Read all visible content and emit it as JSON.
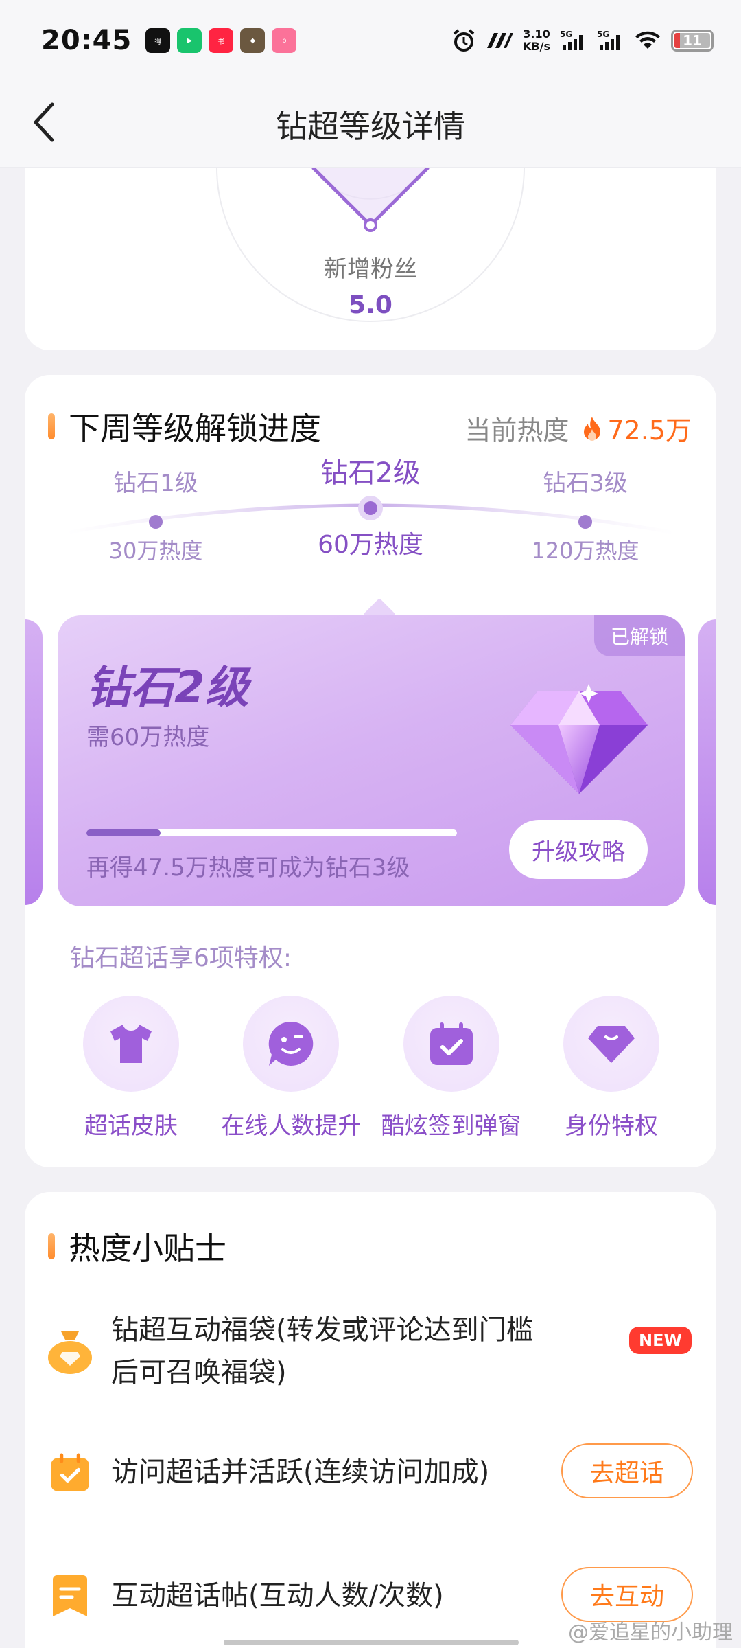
{
  "status_bar": {
    "time": "20:45",
    "apps": [
      "得物",
      "爱奇艺",
      "小红书",
      "游戏",
      "bilibili"
    ],
    "network_speed": "3.10\nKB/s",
    "signal1": "5G",
    "signal2": "5G",
    "battery": "11"
  },
  "header": {
    "title": "钻超等级详情"
  },
  "radar": {
    "label": "新增粉丝",
    "value": "5.0"
  },
  "progress": {
    "section_title": "下周等级解锁进度",
    "heat_label": "当前热度",
    "heat_value": "72.5万",
    "levels": [
      {
        "name": "钻石1级",
        "heat": "30万热度"
      },
      {
        "name": "钻石2级",
        "heat": "60万热度"
      },
      {
        "name": "钻石3级",
        "heat": "120万热度"
      }
    ],
    "card": {
      "unlocked": "已解锁",
      "name": "钻石2级",
      "need": "需60万热度",
      "progress_fraction": 0.2,
      "tip": "再得47.5万热度可成为钻石3级",
      "button": "升级攻略"
    },
    "perk_title": "钻石超话享6项特权:",
    "perks": [
      {
        "label": "超话皮肤",
        "icon": "shirt-icon"
      },
      {
        "label": "在线人数提升",
        "icon": "smile-chat-icon"
      },
      {
        "label": "酷炫签到弹窗",
        "icon": "calendar-check-icon"
      },
      {
        "label": "身份特权",
        "icon": "gem-badge-icon"
      }
    ]
  },
  "tips": {
    "section_title": "热度小贴士",
    "items": [
      {
        "line1": "钻超互动福袋(转发或评论达到门槛",
        "line2": "后可召唤福袋)",
        "badge": "NEW",
        "icon": "lucky-bag-icon"
      },
      {
        "text": "访问超话并活跃(连续访问加成)",
        "button": "去超话",
        "icon": "calendar-check-icon"
      },
      {
        "text": "互动超话帖(互动人数/次数)",
        "button": "去互动",
        "icon": "bookmark-icon"
      }
    ]
  },
  "watermark": "@爱追星的小助理",
  "colors": {
    "accent_purple": "#8550c4",
    "heat_orange": "#ff6a1a",
    "new_red": "#ff3b30"
  }
}
